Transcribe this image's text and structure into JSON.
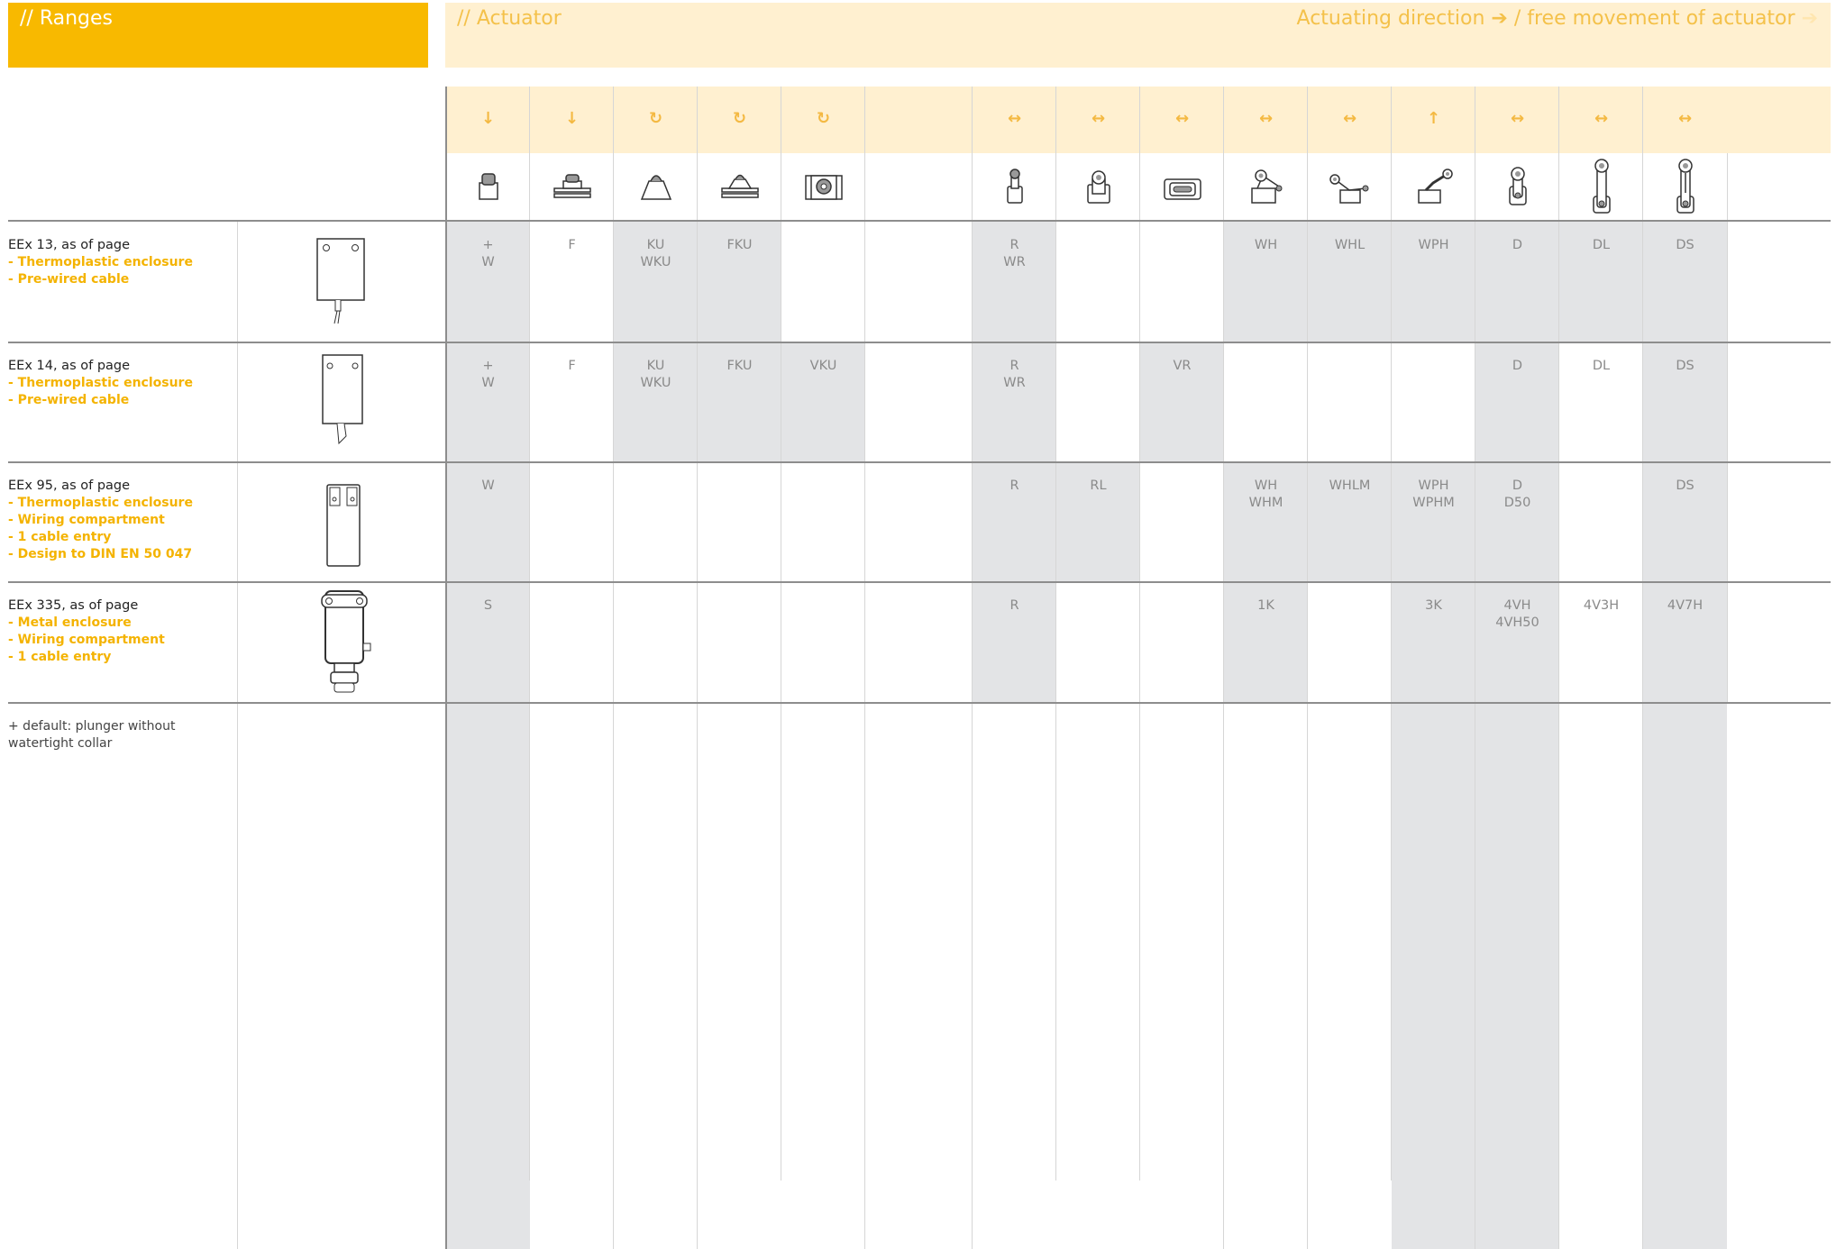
{
  "header": {
    "ranges_title": "// Ranges",
    "actuator_title": "// Actuator",
    "direction_label": "Actuating direction",
    "direction_separator": "/ free movement of actuator",
    "arrow_glyph": "➔"
  },
  "columns": [
    {
      "arrow": "↓",
      "icon": "plunger-icon"
    },
    {
      "arrow": "↓",
      "icon": "flanged-plunger-icon"
    },
    {
      "arrow": "↻",
      "icon": "ball-plunger-icon"
    },
    {
      "arrow": "↻",
      "icon": "flanged-ball-plunger-icon"
    },
    {
      "arrow": "↻",
      "icon": "roller-plunger-icon"
    },
    {
      "arrow": "",
      "icon": ""
    },
    {
      "arrow": "↔",
      "icon": "roller-head-icon"
    },
    {
      "arrow": "↔",
      "icon": "roller-head-wide-icon"
    },
    {
      "arrow": "↔",
      "icon": "cross-roller-icon"
    },
    {
      "arrow": "↔",
      "icon": "roller-lever-icon"
    },
    {
      "arrow": "↔",
      "icon": "long-roller-lever-icon"
    },
    {
      "arrow": "↑",
      "icon": "angled-roller-lever-icon"
    },
    {
      "arrow": "↔",
      "icon": "rotary-lever-icon"
    },
    {
      "arrow": "↔",
      "icon": "long-rotary-lever-icon"
    },
    {
      "arrow": "↔",
      "icon": "adjustable-rotary-lever-icon"
    }
  ],
  "ranges": [
    {
      "title": "EEx 13, as of page",
      "features": [
        "- Thermoplastic enclosure",
        "- Pre-wired cable"
      ],
      "cells": [
        "+\nW",
        "F",
        "KU\nWKU",
        "FKU",
        "",
        "",
        "R\nWR",
        "",
        "",
        "WH",
        "WHL",
        "WPH",
        "D",
        "DL",
        "DS"
      ]
    },
    {
      "title": "EEx 14, as of page",
      "features": [
        "- Thermoplastic enclosure",
        "- Pre-wired cable"
      ],
      "cells": [
        "+\nW",
        "F",
        "KU\nWKU",
        "FKU",
        "VKU",
        "",
        "R\nWR",
        "",
        "VR",
        "",
        "",
        "",
        "D",
        "DL",
        "DS"
      ]
    },
    {
      "title": "EEx 95, as of page",
      "features": [
        "- Thermoplastic enclosure",
        "- Wiring compartment",
        "- 1 cable entry",
        "- Design to DIN EN 50 047"
      ],
      "cells": [
        "W",
        "",
        "",
        "",
        "",
        "",
        "R",
        "RL",
        "",
        "WH\nWHM",
        "WHLM",
        "WPH\nWPHM",
        "D\nD50",
        "",
        "DS"
      ]
    },
    {
      "title": "EEx 335, as of page",
      "features": [
        "- Metal enclosure",
        "- Wiring compartment",
        "- 1 cable entry"
      ],
      "cells": [
        "S",
        "",
        "",
        "",
        "",
        "",
        "R",
        "",
        "",
        "1K",
        "",
        "3K",
        "4VH\n4VH50",
        "4V3H",
        "4V7H"
      ]
    }
  ],
  "footnote": "+ default: plunger without watertight collar",
  "colors": {
    "accent": "#f8b900",
    "light_accent": "#fff0d0",
    "shade": "#e3e4e6"
  }
}
